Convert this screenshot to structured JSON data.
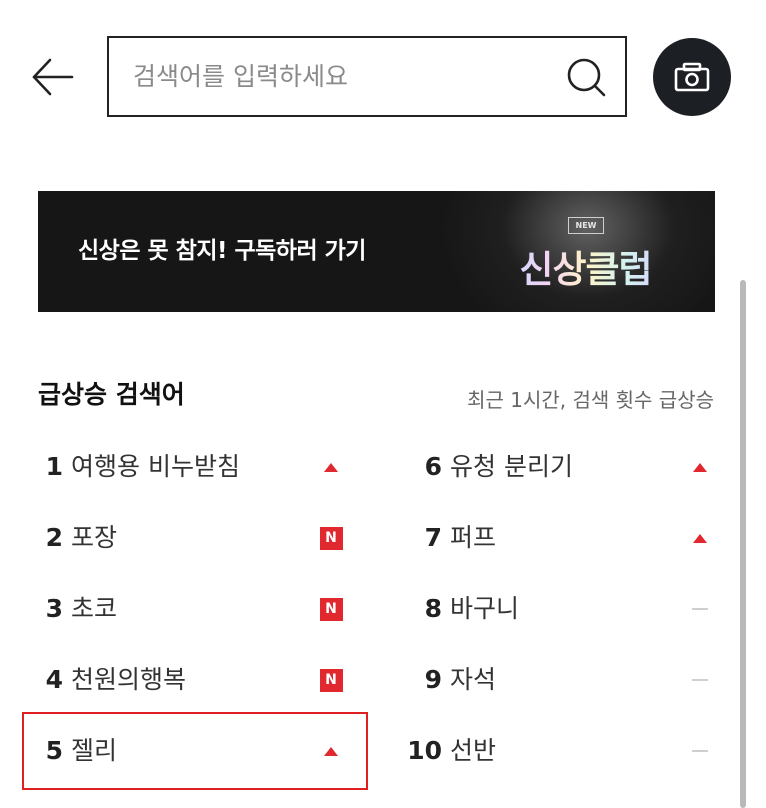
{
  "search": {
    "placeholder": "검색어를 입력하세요"
  },
  "banner": {
    "text": "신상은 못 참지! 구독하러 가기",
    "badge": "NEW",
    "title": "신상클럽"
  },
  "ranking": {
    "title": "급상승 검색어",
    "subtitle": "최근 1시간, 검색 횟수 급상승",
    "left": [
      {
        "rank": "1",
        "term": "여행용 비누받침",
        "status": "up"
      },
      {
        "rank": "2",
        "term": "포장",
        "status": "new",
        "badge": "N"
      },
      {
        "rank": "3",
        "term": "초코",
        "status": "new",
        "badge": "N"
      },
      {
        "rank": "4",
        "term": "천원의행복",
        "status": "new",
        "badge": "N"
      },
      {
        "rank": "5",
        "term": "젤리",
        "status": "up"
      }
    ],
    "right": [
      {
        "rank": "6",
        "term": "유청 분리기",
        "status": "up"
      },
      {
        "rank": "7",
        "term": "퍼프",
        "status": "up"
      },
      {
        "rank": "8",
        "term": "바구니",
        "status": "same"
      },
      {
        "rank": "9",
        "term": "자석",
        "status": "same"
      },
      {
        "rank": "10",
        "term": "선반",
        "status": "same"
      }
    ]
  },
  "colors": {
    "accent": "#e0282e",
    "dark": "#1c1f24"
  }
}
